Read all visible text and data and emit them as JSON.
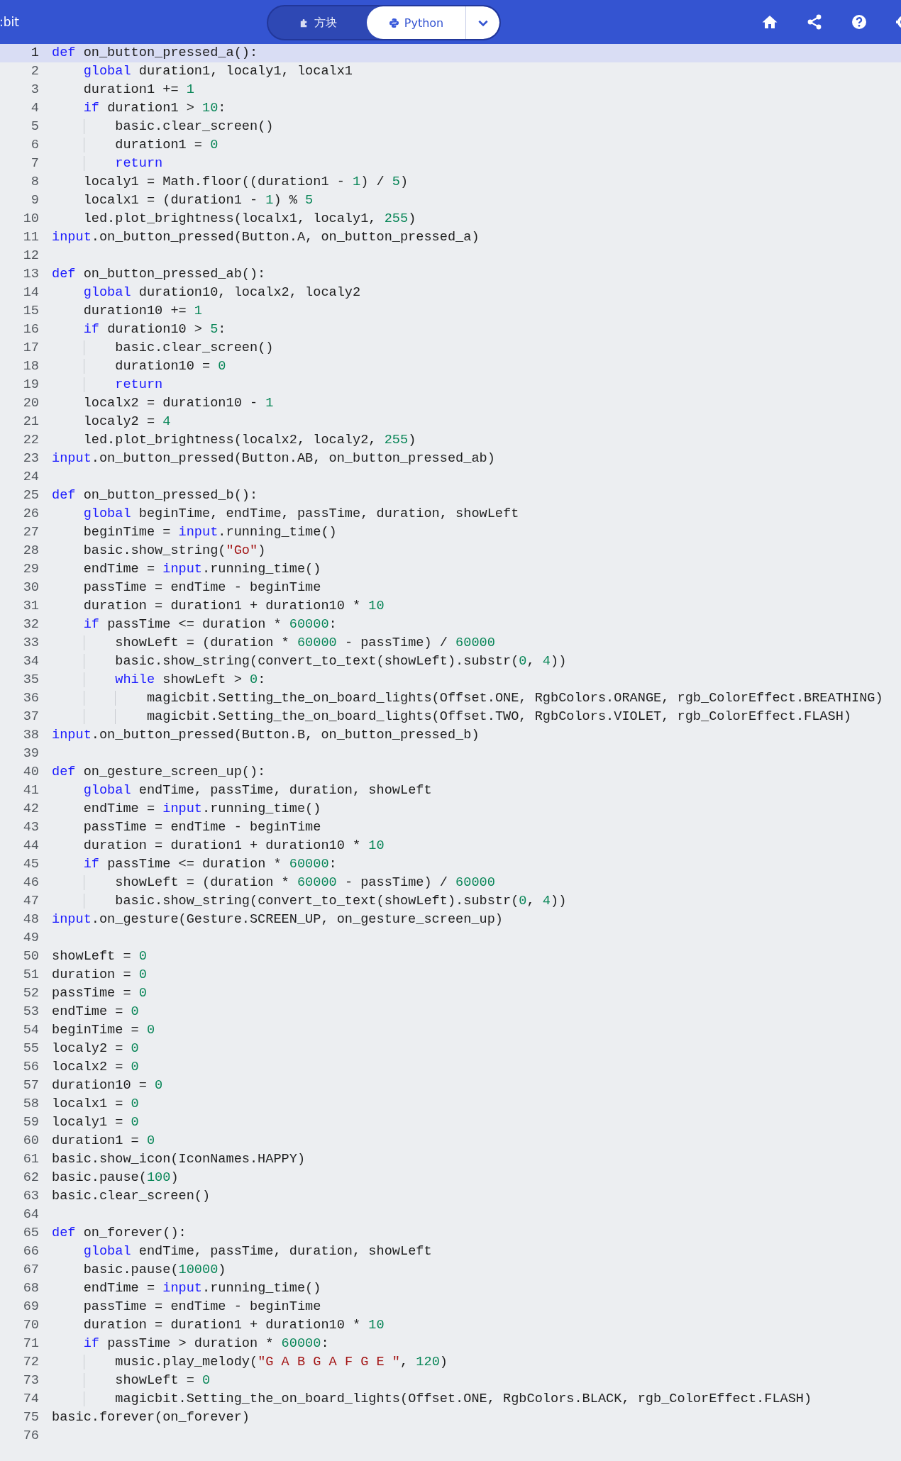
{
  "header": {
    "brand": ":bit",
    "modes": [
      {
        "label": "方块",
        "kind": "blocks",
        "selected": false
      },
      {
        "label": "Python",
        "kind": "python",
        "selected": true
      }
    ]
  },
  "editor": {
    "lines": [
      {
        "number": "1",
        "current": true,
        "tokens": [
          {
            "text": "def",
            "kind": "keyword"
          },
          {
            "text": " on_button_pressed_a():",
            "kind": "plain"
          }
        ]
      },
      {
        "number": "2",
        "current": false,
        "tokens": [
          {
            "text": "    global",
            "kind": "keyword"
          },
          {
            "text": " duration1, localy1, localx1",
            "kind": "plain"
          }
        ]
      },
      {
        "number": "3",
        "current": false,
        "tokens": [
          {
            "text": "    duration1 += ",
            "kind": "plain"
          },
          {
            "text": "1",
            "kind": "number"
          }
        ]
      },
      {
        "number": "4",
        "current": false,
        "tokens": [
          {
            "text": "    if",
            "kind": "keyword"
          },
          {
            "text": " duration1 > ",
            "kind": "plain"
          },
          {
            "text": "10",
            "kind": "number"
          },
          {
            "text": ":",
            "kind": "plain"
          }
        ]
      },
      {
        "number": "5",
        "current": false,
        "tokens": [
          {
            "text": "        basic.clear_screen()",
            "kind": "plain"
          }
        ]
      },
      {
        "number": "6",
        "current": false,
        "tokens": [
          {
            "text": "        duration1 = ",
            "kind": "plain"
          },
          {
            "text": "0",
            "kind": "number"
          }
        ]
      },
      {
        "number": "7",
        "current": false,
        "tokens": [
          {
            "text": "        return",
            "kind": "keyword"
          }
        ]
      },
      {
        "number": "8",
        "current": false,
        "tokens": [
          {
            "text": "    localy1 = Math.floor((duration1 - ",
            "kind": "plain"
          },
          {
            "text": "1",
            "kind": "number"
          },
          {
            "text": ") / ",
            "kind": "plain"
          },
          {
            "text": "5",
            "kind": "number"
          },
          {
            "text": ")",
            "kind": "plain"
          }
        ]
      },
      {
        "number": "9",
        "current": false,
        "tokens": [
          {
            "text": "    localx1 = (duration1 - ",
            "kind": "plain"
          },
          {
            "text": "1",
            "kind": "number"
          },
          {
            "text": ") % ",
            "kind": "plain"
          },
          {
            "text": "5",
            "kind": "number"
          }
        ]
      },
      {
        "number": "10",
        "current": false,
        "tokens": [
          {
            "text": "    led.plot_brightness(localx1, localy1, ",
            "kind": "plain"
          },
          {
            "text": "255",
            "kind": "number"
          },
          {
            "text": ")",
            "kind": "plain"
          }
        ]
      },
      {
        "number": "11",
        "current": false,
        "tokens": [
          {
            "text": "input",
            "kind": "keyword"
          },
          {
            "text": ".on_button_pressed(Button.A, on_button_pressed_a)",
            "kind": "plain"
          }
        ]
      },
      {
        "number": "12",
        "current": false
      },
      {
        "number": "13",
        "current": false,
        "tokens": [
          {
            "text": "def",
            "kind": "keyword"
          },
          {
            "text": " on_button_pressed_ab():",
            "kind": "plain"
          }
        ]
      },
      {
        "number": "14",
        "current": false,
        "tokens": [
          {
            "text": "    global",
            "kind": "keyword"
          },
          {
            "text": " duration10, localx2, localy2",
            "kind": "plain"
          }
        ]
      },
      {
        "number": "15",
        "current": false,
        "tokens": [
          {
            "text": "    duration10 += ",
            "kind": "plain"
          },
          {
            "text": "1",
            "kind": "number"
          }
        ]
      },
      {
        "number": "16",
        "current": false,
        "tokens": [
          {
            "text": "    if",
            "kind": "keyword"
          },
          {
            "text": " duration10 > ",
            "kind": "plain"
          },
          {
            "text": "5",
            "kind": "number"
          },
          {
            "text": ":",
            "kind": "plain"
          }
        ]
      },
      {
        "number": "17",
        "current": false,
        "tokens": [
          {
            "text": "        basic.clear_screen()",
            "kind": "plain"
          }
        ]
      },
      {
        "number": "18",
        "current": false,
        "tokens": [
          {
            "text": "        duration10 = ",
            "kind": "plain"
          },
          {
            "text": "0",
            "kind": "number"
          }
        ]
      },
      {
        "number": "19",
        "current": false,
        "tokens": [
          {
            "text": "        return",
            "kind": "keyword"
          }
        ]
      },
      {
        "number": "20",
        "current": false,
        "tokens": [
          {
            "text": "    localx2 = duration10 - ",
            "kind": "plain"
          },
          {
            "text": "1",
            "kind": "number"
          }
        ]
      },
      {
        "number": "21",
        "current": false,
        "tokens": [
          {
            "text": "    localy2 = ",
            "kind": "plain"
          },
          {
            "text": "4",
            "kind": "number"
          }
        ]
      },
      {
        "number": "22",
        "current": false,
        "tokens": [
          {
            "text": "    led.plot_brightness(localx2, localy2, ",
            "kind": "plain"
          },
          {
            "text": "255",
            "kind": "number"
          },
          {
            "text": ")",
            "kind": "plain"
          }
        ]
      },
      {
        "number": "23",
        "current": false,
        "tokens": [
          {
            "text": "input",
            "kind": "keyword"
          },
          {
            "text": ".on_button_pressed(Button.AB, on_button_pressed_ab)",
            "kind": "plain"
          }
        ]
      },
      {
        "number": "24",
        "current": false
      },
      {
        "number": "25",
        "current": false,
        "tokens": [
          {
            "text": "def",
            "kind": "keyword"
          },
          {
            "text": " on_button_pressed_b():",
            "kind": "plain"
          }
        ]
      },
      {
        "number": "26",
        "current": false,
        "tokens": [
          {
            "text": "    global",
            "kind": "keyword"
          },
          {
            "text": " beginTime, endTime, passTime, duration, showLeft",
            "kind": "plain"
          }
        ]
      },
      {
        "number": "27",
        "current": false,
        "tokens": [
          {
            "text": "    beginTime = ",
            "kind": "plain"
          },
          {
            "text": "input",
            "kind": "keyword"
          },
          {
            "text": ".running_time()",
            "kind": "plain"
          }
        ]
      },
      {
        "number": "28",
        "current": false,
        "tokens": [
          {
            "text": "    basic.show_string(",
            "kind": "plain"
          },
          {
            "text": "\"Go\"",
            "kind": "string"
          },
          {
            "text": ")",
            "kind": "plain"
          }
        ]
      },
      {
        "number": "29",
        "current": false,
        "tokens": [
          {
            "text": "    endTime = ",
            "kind": "plain"
          },
          {
            "text": "input",
            "kind": "keyword"
          },
          {
            "text": ".running_time()",
            "kind": "plain"
          }
        ]
      },
      {
        "number": "30",
        "current": false,
        "tokens": [
          {
            "text": "    passTime = endTime - beginTime",
            "kind": "plain"
          }
        ]
      },
      {
        "number": "31",
        "current": false,
        "tokens": [
          {
            "text": "    duration = duration1 + duration10 * ",
            "kind": "plain"
          },
          {
            "text": "10",
            "kind": "number"
          }
        ]
      },
      {
        "number": "32",
        "current": false,
        "tokens": [
          {
            "text": "    if",
            "kind": "keyword"
          },
          {
            "text": " passTime <= duration * ",
            "kind": "plain"
          },
          {
            "text": "60000",
            "kind": "number"
          },
          {
            "text": ":",
            "kind": "plain"
          }
        ]
      },
      {
        "number": "33",
        "current": false,
        "tokens": [
          {
            "text": "        showLeft = (duration * ",
            "kind": "plain"
          },
          {
            "text": "60000",
            "kind": "number"
          },
          {
            "text": " - passTime) / ",
            "kind": "plain"
          },
          {
            "text": "60000",
            "kind": "number"
          }
        ]
      },
      {
        "number": "34",
        "current": false,
        "tokens": [
          {
            "text": "        basic.show_string(convert_to_text(showLeft).substr(",
            "kind": "plain"
          },
          {
            "text": "0",
            "kind": "number"
          },
          {
            "text": ", ",
            "kind": "plain"
          },
          {
            "text": "4",
            "kind": "number"
          },
          {
            "text": "))",
            "kind": "plain"
          }
        ]
      },
      {
        "number": "35",
        "current": false,
        "tokens": [
          {
            "text": "        while",
            "kind": "keyword"
          },
          {
            "text": " showLeft > ",
            "kind": "plain"
          },
          {
            "text": "0",
            "kind": "number"
          },
          {
            "text": ":",
            "kind": "plain"
          }
        ]
      },
      {
        "number": "36",
        "current": false,
        "tokens": [
          {
            "text": "            magicbit.Setting_the_on_board_lights(Offset.ONE, RgbColors.ORANGE, rgb_ColorEffect.BREATHING)",
            "kind": "plain"
          }
        ]
      },
      {
        "number": "37",
        "current": false,
        "tokens": [
          {
            "text": "            magicbit.Setting_the_on_board_lights(Offset.TWO, RgbColors.VIOLET, rgb_ColorEffect.FLASH)",
            "kind": "plain"
          }
        ]
      },
      {
        "number": "38",
        "current": false,
        "tokens": [
          {
            "text": "input",
            "kind": "keyword"
          },
          {
            "text": ".on_button_pressed(Button.B, on_button_pressed_b)",
            "kind": "plain"
          }
        ]
      },
      {
        "number": "39",
        "current": false
      },
      {
        "number": "40",
        "current": false,
        "tokens": [
          {
            "text": "def",
            "kind": "keyword"
          },
          {
            "text": " on_gesture_screen_up():",
            "kind": "plain"
          }
        ]
      },
      {
        "number": "41",
        "current": false,
        "tokens": [
          {
            "text": "    global",
            "kind": "keyword"
          },
          {
            "text": " endTime, passTime, duration, showLeft",
            "kind": "plain"
          }
        ]
      },
      {
        "number": "42",
        "current": false,
        "tokens": [
          {
            "text": "    endTime = ",
            "kind": "plain"
          },
          {
            "text": "input",
            "kind": "keyword"
          },
          {
            "text": ".running_time()",
            "kind": "plain"
          }
        ]
      },
      {
        "number": "43",
        "current": false,
        "tokens": [
          {
            "text": "    passTime = endTime - beginTime",
            "kind": "plain"
          }
        ]
      },
      {
        "number": "44",
        "current": false,
        "tokens": [
          {
            "text": "    duration = duration1 + duration10 * ",
            "kind": "plain"
          },
          {
            "text": "10",
            "kind": "number"
          }
        ]
      },
      {
        "number": "45",
        "current": false,
        "tokens": [
          {
            "text": "    if",
            "kind": "keyword"
          },
          {
            "text": " passTime <= duration * ",
            "kind": "plain"
          },
          {
            "text": "60000",
            "kind": "number"
          },
          {
            "text": ":",
            "kind": "plain"
          }
        ]
      },
      {
        "number": "46",
        "current": false,
        "tokens": [
          {
            "text": "        showLeft = (duration * ",
            "kind": "plain"
          },
          {
            "text": "60000",
            "kind": "number"
          },
          {
            "text": " - passTime) / ",
            "kind": "plain"
          },
          {
            "text": "60000",
            "kind": "number"
          }
        ]
      },
      {
        "number": "47",
        "current": false,
        "tokens": [
          {
            "text": "        basic.show_string(convert_to_text(showLeft).substr(",
            "kind": "plain"
          },
          {
            "text": "0",
            "kind": "number"
          },
          {
            "text": ", ",
            "kind": "plain"
          },
          {
            "text": "4",
            "kind": "number"
          },
          {
            "text": "))",
            "kind": "plain"
          }
        ]
      },
      {
        "number": "48",
        "current": false,
        "tokens": [
          {
            "text": "input",
            "kind": "keyword"
          },
          {
            "text": ".on_gesture(Gesture.SCREEN_UP, on_gesture_screen_up)",
            "kind": "plain"
          }
        ]
      },
      {
        "number": "49",
        "current": false
      },
      {
        "number": "50",
        "current": false,
        "tokens": [
          {
            "text": "showLeft = ",
            "kind": "plain"
          },
          {
            "text": "0",
            "kind": "number"
          }
        ]
      },
      {
        "number": "51",
        "current": false,
        "tokens": [
          {
            "text": "duration = ",
            "kind": "plain"
          },
          {
            "text": "0",
            "kind": "number"
          }
        ]
      },
      {
        "number": "52",
        "current": false,
        "tokens": [
          {
            "text": "passTime = ",
            "kind": "plain"
          },
          {
            "text": "0",
            "kind": "number"
          }
        ]
      },
      {
        "number": "53",
        "current": false,
        "tokens": [
          {
            "text": "endTime = ",
            "kind": "plain"
          },
          {
            "text": "0",
            "kind": "number"
          }
        ]
      },
      {
        "number": "54",
        "current": false,
        "tokens": [
          {
            "text": "beginTime = ",
            "kind": "plain"
          },
          {
            "text": "0",
            "kind": "number"
          }
        ]
      },
      {
        "number": "55",
        "current": false,
        "tokens": [
          {
            "text": "localy2 = ",
            "kind": "plain"
          },
          {
            "text": "0",
            "kind": "number"
          }
        ]
      },
      {
        "number": "56",
        "current": false,
        "tokens": [
          {
            "text": "localx2 = ",
            "kind": "plain"
          },
          {
            "text": "0",
            "kind": "number"
          }
        ]
      },
      {
        "number": "57",
        "current": false,
        "tokens": [
          {
            "text": "duration10 = ",
            "kind": "plain"
          },
          {
            "text": "0",
            "kind": "number"
          }
        ]
      },
      {
        "number": "58",
        "current": false,
        "tokens": [
          {
            "text": "localx1 = ",
            "kind": "plain"
          },
          {
            "text": "0",
            "kind": "number"
          }
        ]
      },
      {
        "number": "59",
        "current": false,
        "tokens": [
          {
            "text": "localy1 = ",
            "kind": "plain"
          },
          {
            "text": "0",
            "kind": "number"
          }
        ]
      },
      {
        "number": "60",
        "current": false,
        "tokens": [
          {
            "text": "duration1 = ",
            "kind": "plain"
          },
          {
            "text": "0",
            "kind": "number"
          }
        ]
      },
      {
        "number": "61",
        "current": false,
        "tokens": [
          {
            "text": "basic.show_icon(IconNames.HAPPY)",
            "kind": "plain"
          }
        ]
      },
      {
        "number": "62",
        "current": false,
        "tokens": [
          {
            "text": "basic.pause(",
            "kind": "plain"
          },
          {
            "text": "100",
            "kind": "number"
          },
          {
            "text": ")",
            "kind": "plain"
          }
        ]
      },
      {
        "number": "63",
        "current": false,
        "tokens": [
          {
            "text": "basic.clear_screen()",
            "kind": "plain"
          }
        ]
      },
      {
        "number": "64",
        "current": false
      },
      {
        "number": "65",
        "current": false,
        "tokens": [
          {
            "text": "def",
            "kind": "keyword"
          },
          {
            "text": " on_forever():",
            "kind": "plain"
          }
        ]
      },
      {
        "number": "66",
        "current": false,
        "tokens": [
          {
            "text": "    global",
            "kind": "keyword"
          },
          {
            "text": " endTime, passTime, duration, showLeft",
            "kind": "plain"
          }
        ]
      },
      {
        "number": "67",
        "current": false,
        "tokens": [
          {
            "text": "    basic.pause(",
            "kind": "plain"
          },
          {
            "text": "10000",
            "kind": "number"
          },
          {
            "text": ")",
            "kind": "plain"
          }
        ]
      },
      {
        "number": "68",
        "current": false,
        "tokens": [
          {
            "text": "    endTime = ",
            "kind": "plain"
          },
          {
            "text": "input",
            "kind": "keyword"
          },
          {
            "text": ".running_time()",
            "kind": "plain"
          }
        ]
      },
      {
        "number": "69",
        "current": false,
        "tokens": [
          {
            "text": "    passTime = endTime - beginTime",
            "kind": "plain"
          }
        ]
      },
      {
        "number": "70",
        "current": false,
        "tokens": [
          {
            "text": "    duration = duration1 + duration10 * ",
            "kind": "plain"
          },
          {
            "text": "10",
            "kind": "number"
          }
        ]
      },
      {
        "number": "71",
        "current": false,
        "tokens": [
          {
            "text": "    if",
            "kind": "keyword"
          },
          {
            "text": " passTime > duration * ",
            "kind": "plain"
          },
          {
            "text": "60000",
            "kind": "number"
          },
          {
            "text": ":",
            "kind": "plain"
          }
        ]
      },
      {
        "number": "72",
        "current": false,
        "tokens": [
          {
            "text": "        music.play_melody(",
            "kind": "plain"
          },
          {
            "text": "\"G A B G A F G E \"",
            "kind": "string"
          },
          {
            "text": ", ",
            "kind": "plain"
          },
          {
            "text": "120",
            "kind": "number"
          },
          {
            "text": ")",
            "kind": "plain"
          }
        ]
      },
      {
        "number": "73",
        "current": false,
        "tokens": [
          {
            "text": "        showLeft = ",
            "kind": "plain"
          },
          {
            "text": "0",
            "kind": "number"
          }
        ]
      },
      {
        "number": "74",
        "current": false,
        "tokens": [
          {
            "text": "        magicbit.Setting_the_on_board_lights(Offset.ONE, RgbColors.BLACK, rgb_ColorEffect.FLASH)",
            "kind": "plain"
          }
        ]
      },
      {
        "number": "75",
        "current": false,
        "tokens": [
          {
            "text": "basic.forever(on_forever)",
            "kind": "plain"
          }
        ]
      },
      {
        "number": "76",
        "current": false
      }
    ]
  }
}
